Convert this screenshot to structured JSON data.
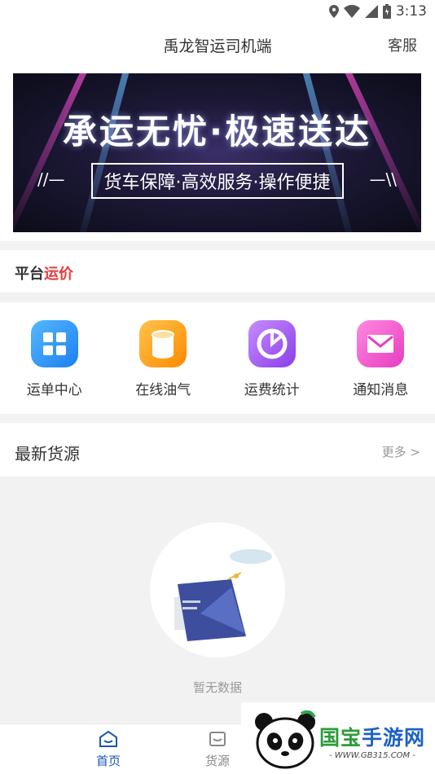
{
  "status_bar": {
    "time": "3:13"
  },
  "header": {
    "title": "禹龙智运司机端",
    "service_label": "客服"
  },
  "banner": {
    "headline": "承运无忧·极速送达",
    "subline": "货车保障·高效服务·操作便捷",
    "deco_left": "//—",
    "deco_right": "—\\\\"
  },
  "platform": {
    "prefix": "平台",
    "highlight": "运价",
    "highlight_color": "#e53b3b"
  },
  "grid": {
    "items": [
      {
        "label": "运单中心",
        "icon": "waybill-grid-icon"
      },
      {
        "label": "在线油气",
        "icon": "fuel-cylinder-icon"
      },
      {
        "label": "运费统计",
        "icon": "pie-chart-icon"
      },
      {
        "label": "通知消息",
        "icon": "mail-icon"
      }
    ]
  },
  "latest": {
    "title": "最新货源",
    "more_label": "更多 >"
  },
  "empty": {
    "text": "暂无数据"
  },
  "tabbar": {
    "tabs": [
      {
        "label": "首页",
        "icon": "home-icon",
        "active": true
      },
      {
        "label": "货源",
        "icon": "cargo-icon",
        "active": false
      }
    ],
    "accent": "#1a55b6"
  },
  "watermark": {
    "brand_part1": "国宝",
    "brand_part2": "手游网",
    "url": "- WWW.GB315.COM -"
  }
}
